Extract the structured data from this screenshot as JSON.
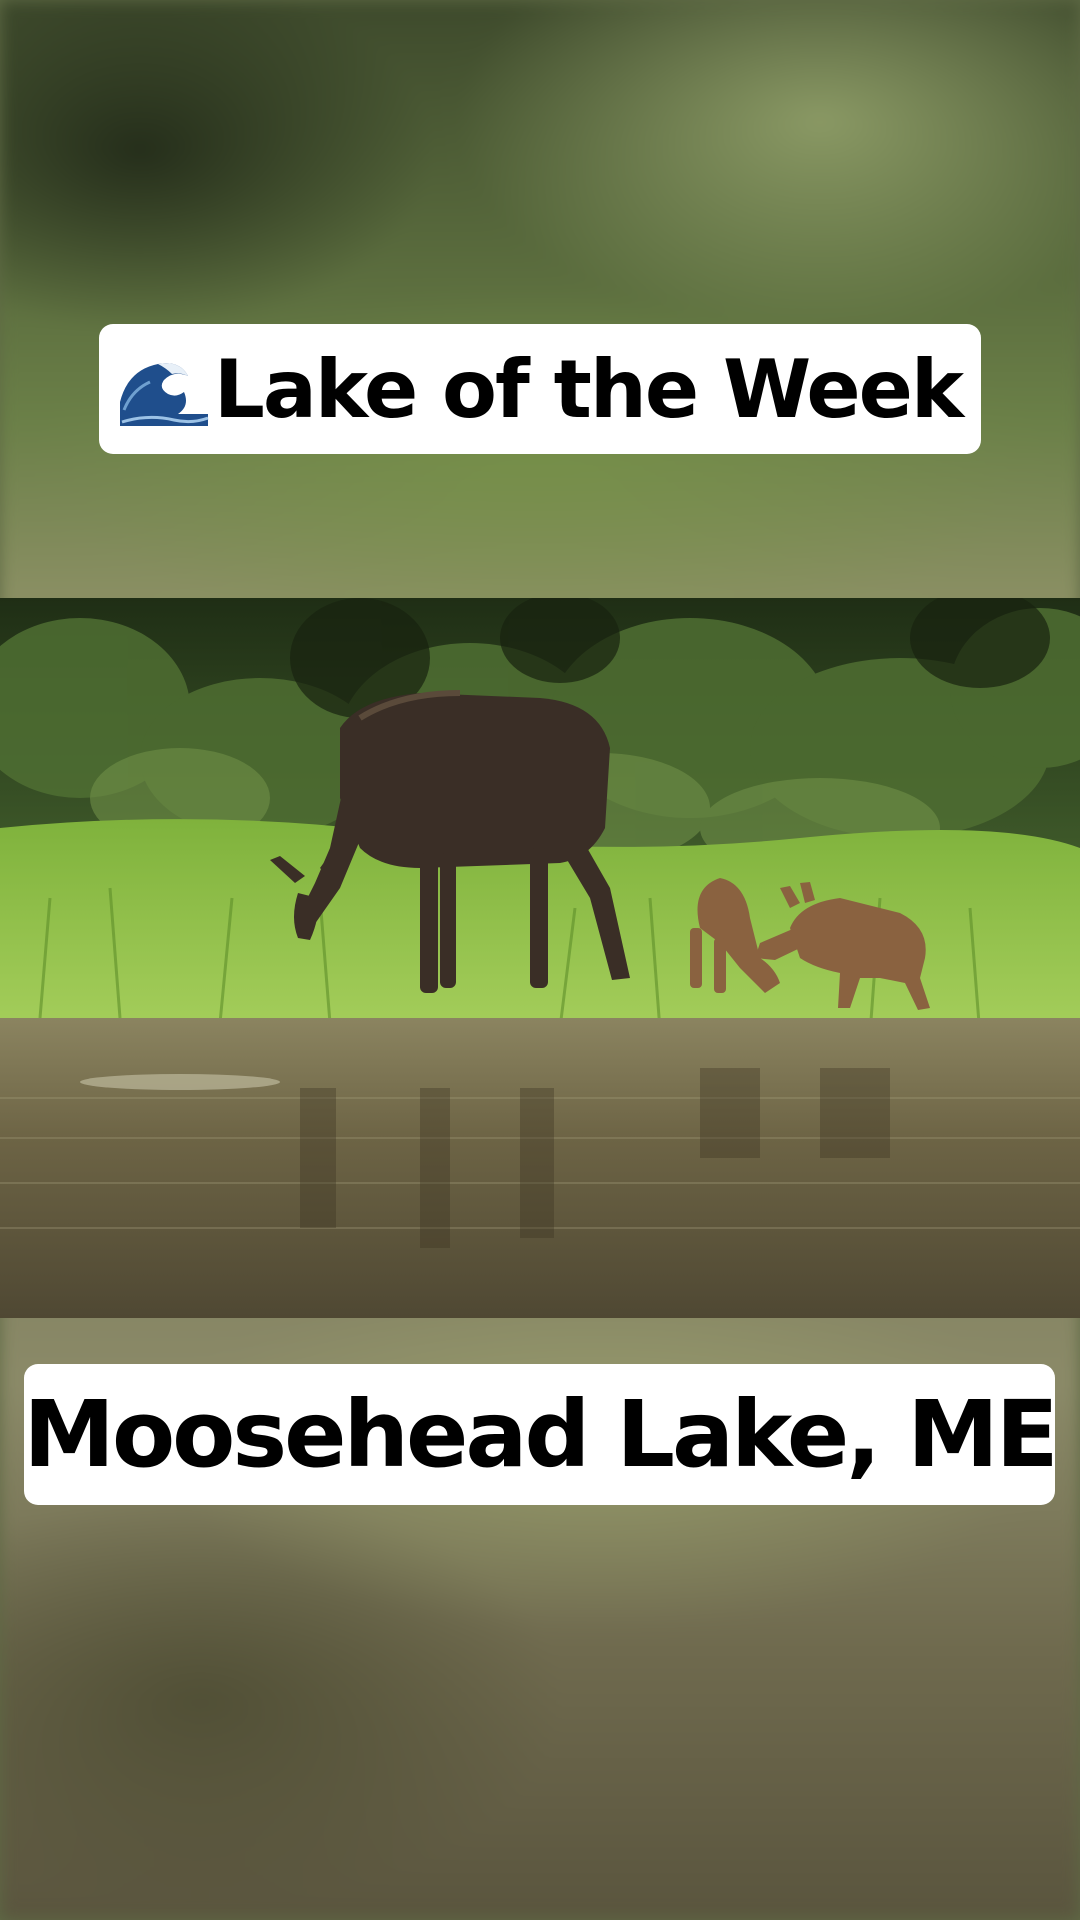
{
  "title_caption": {
    "icon": "wave-icon",
    "text": "Lake of the Week"
  },
  "location_caption": {
    "text": "Moosehead Lake, ME"
  },
  "photo": {
    "subject": "moose-cow-and-calves-in-lake-photo",
    "colors": {
      "forest": "#2f4220",
      "grass": "#8fbf48",
      "water": "#6f6448",
      "moose": "#3a2e26",
      "calf": "#8a6240"
    }
  }
}
